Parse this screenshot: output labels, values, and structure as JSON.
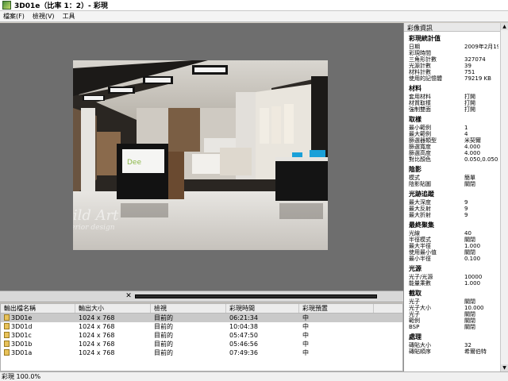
{
  "window": {
    "title": "3D01e（比率 1：2）- 彩現"
  },
  "menu": [
    {
      "label": "檔案(F)"
    },
    {
      "label": "檢視(V)"
    },
    {
      "label": "工具"
    }
  ],
  "watermark": {
    "line1": "Build Art",
    "line2": "interior design"
  },
  "signage": {
    "logo": "Dee"
  },
  "list": {
    "columns": [
      "輸出檔名稱",
      "輸出大小",
      "檢視",
      "彩現時間",
      "彩現預置"
    ],
    "rows": [
      {
        "name": "3D01e",
        "size": "1024 x 768",
        "view": "目前的",
        "time": "06:21:34",
        "preset": "中"
      },
      {
        "name": "3D01d",
        "size": "1024 x 768",
        "view": "目前的",
        "time": "10:04:38",
        "preset": "中"
      },
      {
        "name": "3D01c",
        "size": "1024 x 768",
        "view": "目前的",
        "time": "05:47:50",
        "preset": "中"
      },
      {
        "name": "3D01b",
        "size": "1024 x 768",
        "view": "目前的",
        "time": "05:46:56",
        "preset": "中"
      },
      {
        "name": "3D01a",
        "size": "1024 x 768",
        "view": "目前的",
        "time": "07:49:36",
        "preset": "中"
      }
    ],
    "selected_index": 0
  },
  "status": {
    "text": "彩現 100.0%"
  },
  "info": {
    "title": "彩像資訊",
    "sections": [
      {
        "title": "彩現統計值",
        "items": [
          {
            "k": "日期",
            "v": "2009年2月19日"
          },
          {
            "k": "彩現時間",
            "v": ""
          },
          {
            "k": "三角形計數",
            "v": "327074"
          },
          {
            "k": "光源計數",
            "v": "39"
          },
          {
            "k": "材料計數",
            "v": "751"
          },
          {
            "k": "使用的記憶體",
            "v": "79219 KB"
          }
        ]
      },
      {
        "title": "材料",
        "items": [
          {
            "k": "套用材料",
            "v": "打開"
          },
          {
            "k": "材質取樣",
            "v": "打開"
          },
          {
            "k": "強制雙面",
            "v": "打開"
          }
        ]
      },
      {
        "title": "取樣",
        "items": [
          {
            "k": "最小範例",
            "v": "1"
          },
          {
            "k": "最大範例",
            "v": "4"
          },
          {
            "k": "篩選器類型",
            "v": "米契爾"
          },
          {
            "k": "篩選寬度",
            "v": "4.000"
          },
          {
            "k": "篩選高度",
            "v": "4.000"
          },
          {
            "k": "對比顏色",
            "v": "0.050,0.050,0.050"
          }
        ]
      },
      {
        "title": "陰影",
        "items": [
          {
            "k": "模式",
            "v": "簡單"
          },
          {
            "k": "陰影貼圖",
            "v": "關閉"
          }
        ]
      },
      {
        "title": "光跡追蹤",
        "items": [
          {
            "k": "最大深度",
            "v": "9"
          },
          {
            "k": "最大反射",
            "v": "9"
          },
          {
            "k": "最大折射",
            "v": "9"
          }
        ]
      },
      {
        "title": "最終聚集",
        "items": [
          {
            "k": "光線",
            "v": "40"
          },
          {
            "k": "半徑模式",
            "v": "關閉"
          },
          {
            "k": "最大半徑",
            "v": "1.000"
          },
          {
            "k": "使用最小值",
            "v": "關閉"
          },
          {
            "k": "最小半徑",
            "v": "0.100"
          }
        ]
      },
      {
        "title": "光源",
        "items": [
          {
            "k": "光子/光源",
            "v": "10000"
          },
          {
            "k": "能量乘數",
            "v": "1.000"
          }
        ]
      },
      {
        "title": "截取",
        "items": [
          {
            "k": "光子",
            "v": "關閉"
          },
          {
            "k": "光子大小",
            "v": "10.000"
          },
          {
            "k": "光子",
            "v": "關閉"
          },
          {
            "k": "範例",
            "v": "關閉"
          },
          {
            "k": "BSP",
            "v": "關閉"
          }
        ]
      },
      {
        "title": "處理",
        "items": [
          {
            "k": "磚貼大小",
            "v": "32"
          },
          {
            "k": "磚貼順序",
            "v": "希爾伯特"
          }
        ]
      }
    ]
  },
  "colors": {
    "viewport_bg": "#6e6e6e",
    "selected_row": "#c9c9c9",
    "accent_green": "#8cb84a"
  }
}
